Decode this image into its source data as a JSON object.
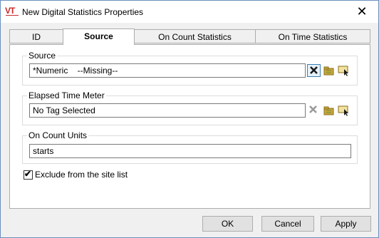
{
  "window": {
    "title": "New Digital Statistics Properties",
    "app_icon_text": "VT",
    "close_symbol": "✕"
  },
  "tabs": [
    {
      "label": "ID",
      "active": false
    },
    {
      "label": "Source",
      "active": true
    },
    {
      "label": "On Count Statistics",
      "active": false
    },
    {
      "label": "On Time Statistics",
      "active": false
    }
  ],
  "source_group": {
    "label": "Source",
    "value": "*Numeric    --Missing--",
    "icons": [
      "clear-icon",
      "tag-browse-icon",
      "tag-select-icon"
    ]
  },
  "elapsed_group": {
    "label": "Elapsed Time Meter",
    "value": "No Tag Selected",
    "icons": [
      "clear-icon",
      "tag-browse-icon",
      "tag-select-icon"
    ]
  },
  "units_group": {
    "label": "On Count Units",
    "value": "starts"
  },
  "exclude": {
    "label": "Exclude from the site list",
    "checked": true,
    "check_glyph": "✔"
  },
  "buttons": {
    "ok": "OK",
    "cancel": "Cancel",
    "apply": "Apply"
  },
  "colors": {
    "accent": "#3c7fb1",
    "brand_red": "#cc2a2a",
    "clear_icon_active": "#1a1a1a",
    "clear_icon_disabled": "#9a9a9a",
    "folder": "#c9a63a",
    "check": "#000000"
  }
}
